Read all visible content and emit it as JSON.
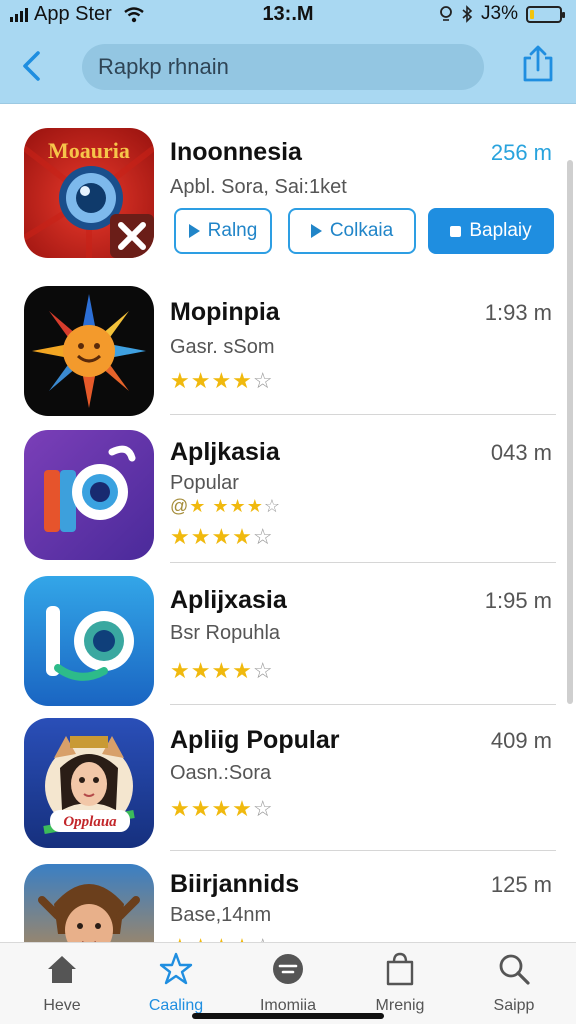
{
  "status_bar": {
    "carrier": "App Ster",
    "time": "13:.M",
    "battery_text": "J3%",
    "battery_level": 0.15,
    "battery_color": "#f2c40d"
  },
  "nav": {
    "back_icon": "chevron-left-icon",
    "search_value": "Rapkp rhnain",
    "share_icon": "share-icon"
  },
  "apps": [
    {
      "name": "Inoonnesia",
      "subtitle": "Apbl. Sora, Sai:1ket",
      "size": "256 m",
      "icon_text": "Moauria",
      "actions": [
        {
          "label": "Ralng",
          "icon": "play-icon"
        },
        {
          "label": "Colkaia",
          "icon": "play-icon"
        },
        {
          "label": "Baplaiy",
          "icon": "stop-icon"
        }
      ]
    },
    {
      "name": "Mopinpia",
      "subtitle": "Gasr. sSom",
      "size": "1:93 m",
      "rating": 4
    },
    {
      "name": "Apljkasia",
      "subtitle": "Popular",
      "subtitle_rating_prefix": "@",
      "size": "043 m",
      "rating": 4
    },
    {
      "name": "Aplijxasia",
      "subtitle": "Bsr Ropuhla",
      "size": "1:95 m",
      "rating": 4
    },
    {
      "name": "Apliig Popular",
      "subtitle": "Oasn.:Sora",
      "size": "409 m",
      "rating": 4,
      "icon_text": "Opplaua"
    },
    {
      "name": "Biirjannids",
      "subtitle": "Base,14nm",
      "size": "125 m",
      "rating": 4
    }
  ],
  "tabs": [
    {
      "label": "Heve",
      "icon": "home-icon",
      "active": false
    },
    {
      "label": "Caaling",
      "icon": "star-icon",
      "active": true
    },
    {
      "label": "Imomiia",
      "icon": "circle-filter-icon",
      "active": false
    },
    {
      "label": "Mrenig",
      "icon": "bag-icon",
      "active": false
    },
    {
      "label": "Saipp",
      "icon": "search-icon",
      "active": false
    }
  ],
  "colors": {
    "accent": "#1f8ee0",
    "header_bg": "#a9d8f2",
    "star": "#f0b90e"
  }
}
